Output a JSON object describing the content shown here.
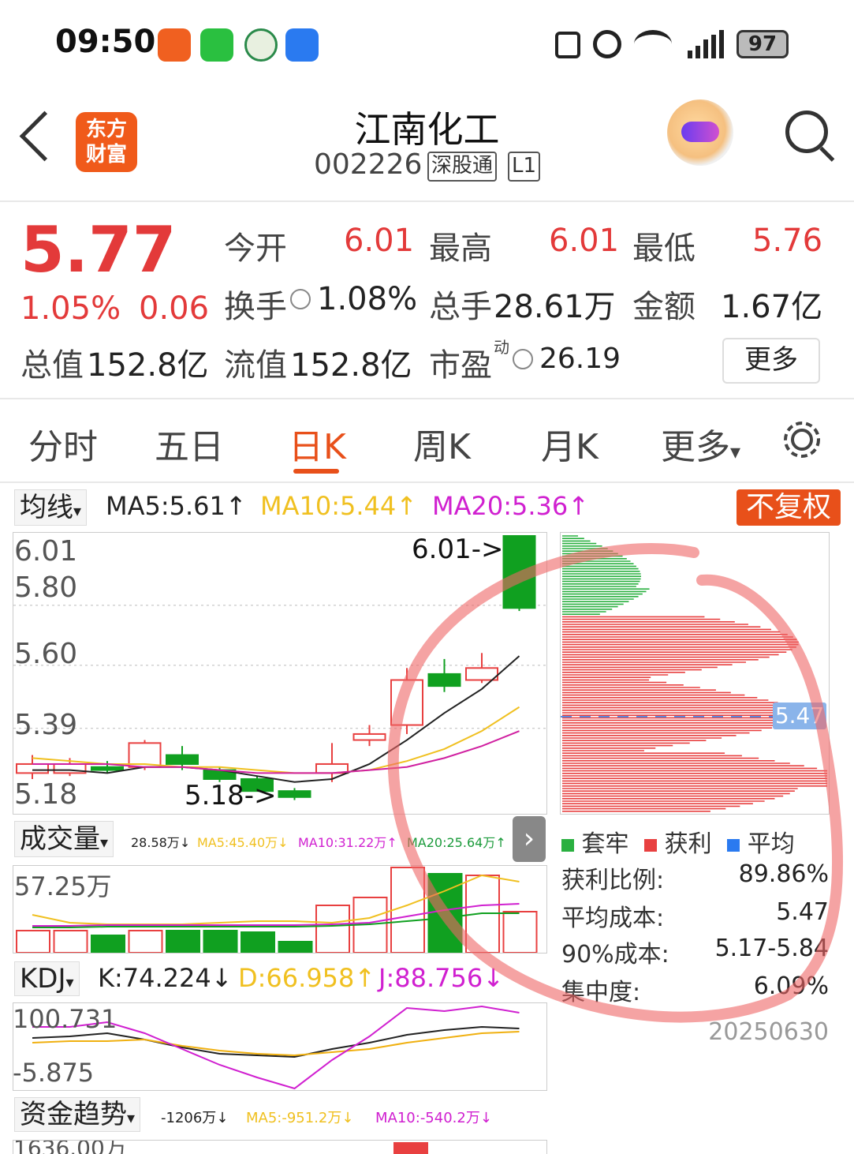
{
  "status_bar": {
    "time": "09:50",
    "battery": "97"
  },
  "header": {
    "logo_line1": "东方",
    "logo_line2": "财富",
    "name": "江南化工",
    "code": "002226",
    "tag1": "深股通",
    "tag2": "L1"
  },
  "quote": {
    "price": "5.77",
    "pct": "1.05%",
    "change": "0.06",
    "open_label": "今开",
    "open": "6.01",
    "high_label": "最高",
    "high": "6.01",
    "low_label": "最低",
    "low": "5.76",
    "turnover_label": "换手",
    "turnover": "1.08%",
    "volume_label": "总手",
    "volume": "28.61万",
    "amount_label": "金额",
    "amount": "1.67亿",
    "mktcap_label": "总值",
    "mktcap": "152.8亿",
    "float_label": "流值",
    "float": "152.8亿",
    "pe_label": "市盈",
    "pe_sup": "动",
    "pe": "26.19",
    "more": "更多"
  },
  "tabs": [
    "分时",
    "五日",
    "日K",
    "周K",
    "月K",
    "更多"
  ],
  "active_tab": "日K",
  "ma_bar": {
    "dropdown": "均线",
    "ma5": "MA5:5.61",
    "ma10": "MA10:5.44",
    "ma20": "MA20:5.36",
    "fq": "不复权"
  },
  "kline": {
    "y_labels": [
      "6.01",
      "5.80",
      "5.60",
      "5.39",
      "5.18"
    ],
    "high_note": "6.01->",
    "low_note": "5.18->"
  },
  "chip": {
    "avg_label": "5.47",
    "legend": [
      "套牢",
      "获利",
      "平均"
    ],
    "rows": [
      {
        "label": "获利比例:",
        "value": "89.86%"
      },
      {
        "label": "平均成本:",
        "value": "5.47"
      },
      {
        "label": "90%成本:",
        "value": "5.17-5.84"
      },
      {
        "label": "集中度:",
        "value": "6.09%"
      }
    ],
    "date": "20250630"
  },
  "vol_bar": {
    "dropdown": "成交量",
    "vol": "28.58万",
    "ma5": "MA5:45.40万",
    "ma10": "MA10:31.22万",
    "ma20": "MA20:25.64万",
    "max": "57.25万"
  },
  "kdj_bar": {
    "dropdown": "KDJ",
    "k": "K:74.224",
    "d": "D:66.958",
    "j": "J:88.756",
    "max": "100.731",
    "min": "-5.875"
  },
  "fund_bar": {
    "dropdown": "资金趋势",
    "val": "-1206万",
    "ma5": "MA5:-951.2万",
    "ma10": "MA10:-540.2万",
    "partial": "1636.00万"
  },
  "chart_data": {
    "type": "candlestick",
    "ylim": [
      5.18,
      6.01
    ],
    "candles": [
      {
        "o": 5.22,
        "c": 5.25,
        "h": 5.28,
        "l": 5.2,
        "up": true
      },
      {
        "o": 5.25,
        "c": 5.22,
        "h": 5.27,
        "l": 5.21,
        "up": true
      },
      {
        "o": 5.23,
        "c": 5.24,
        "h": 5.26,
        "l": 5.22,
        "up": false
      },
      {
        "o": 5.24,
        "c": 5.32,
        "h": 5.33,
        "l": 5.23,
        "up": true
      },
      {
        "o": 5.28,
        "c": 5.25,
        "h": 5.31,
        "l": 5.23,
        "up": false
      },
      {
        "o": 5.23,
        "c": 5.2,
        "h": 5.24,
        "l": 5.19,
        "up": false
      },
      {
        "o": 5.2,
        "c": 5.16,
        "h": 5.21,
        "l": 5.16,
        "up": false
      },
      {
        "o": 5.16,
        "c": 5.14,
        "h": 5.17,
        "l": 5.13,
        "up": false
      },
      {
        "o": 5.22,
        "c": 5.25,
        "h": 5.32,
        "l": 5.19,
        "up": true
      },
      {
        "o": 5.33,
        "c": 5.35,
        "h": 5.38,
        "l": 5.31,
        "up": true
      },
      {
        "o": 5.38,
        "c": 5.53,
        "h": 5.57,
        "l": 5.35,
        "up": true
      },
      {
        "o": 5.55,
        "c": 5.51,
        "h": 5.6,
        "l": 5.49,
        "up": false
      },
      {
        "o": 5.53,
        "c": 5.57,
        "h": 5.62,
        "l": 5.52,
        "up": true
      },
      {
        "o": 6.01,
        "c": 5.77,
        "h": 6.01,
        "l": 5.76,
        "up": false
      }
    ]
  }
}
